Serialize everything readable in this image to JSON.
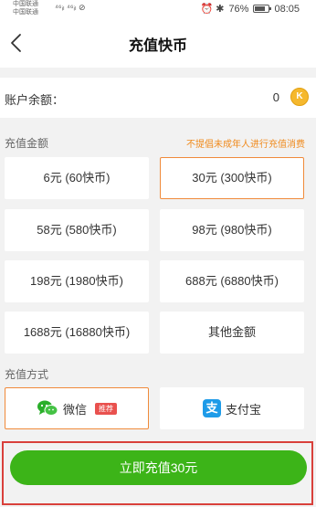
{
  "status_bar": {
    "carrier_1": "中国联通",
    "carrier_2": "中国联通",
    "signal": "⁴⁶ᵢₗ ⁴⁶ᵢₗ ⊘",
    "icons": "⏰ ✱",
    "battery": "76%",
    "time": "08:05"
  },
  "nav": {
    "back_icon": "chevron-left-icon",
    "title": "充值快币"
  },
  "balance": {
    "label": "账户余额：",
    "value": "0",
    "coin_symbol": "K"
  },
  "amount_section": {
    "label": "充值金额",
    "notice": "不提倡未成年人进行充值消费",
    "options": [
      {
        "label": "6元 (60快币)",
        "selected": false
      },
      {
        "label": "30元 (300快币)",
        "selected": true
      },
      {
        "label": "58元 (580快币)",
        "selected": false
      },
      {
        "label": "98元 (980快币)",
        "selected": false
      },
      {
        "label": "198元 (1980快币)",
        "selected": false
      },
      {
        "label": "688元 (6880快币)",
        "selected": false
      },
      {
        "label": "1688元 (16880快币)",
        "selected": false
      },
      {
        "label": "其他金额",
        "selected": false
      }
    ]
  },
  "method_section": {
    "label": "充值方式",
    "wechat": {
      "label": "微信",
      "badge": "推荐",
      "selected": true
    },
    "alipay": {
      "label": "支付宝",
      "icon_char": "支",
      "selected": false
    }
  },
  "charge_button": {
    "label": "立即充值30元"
  },
  "colors": {
    "accent_orange": "#f08a3a",
    "notice_orange": "#f08a1c",
    "button_green": "#3cb418",
    "highlight_red": "#d9403b"
  }
}
